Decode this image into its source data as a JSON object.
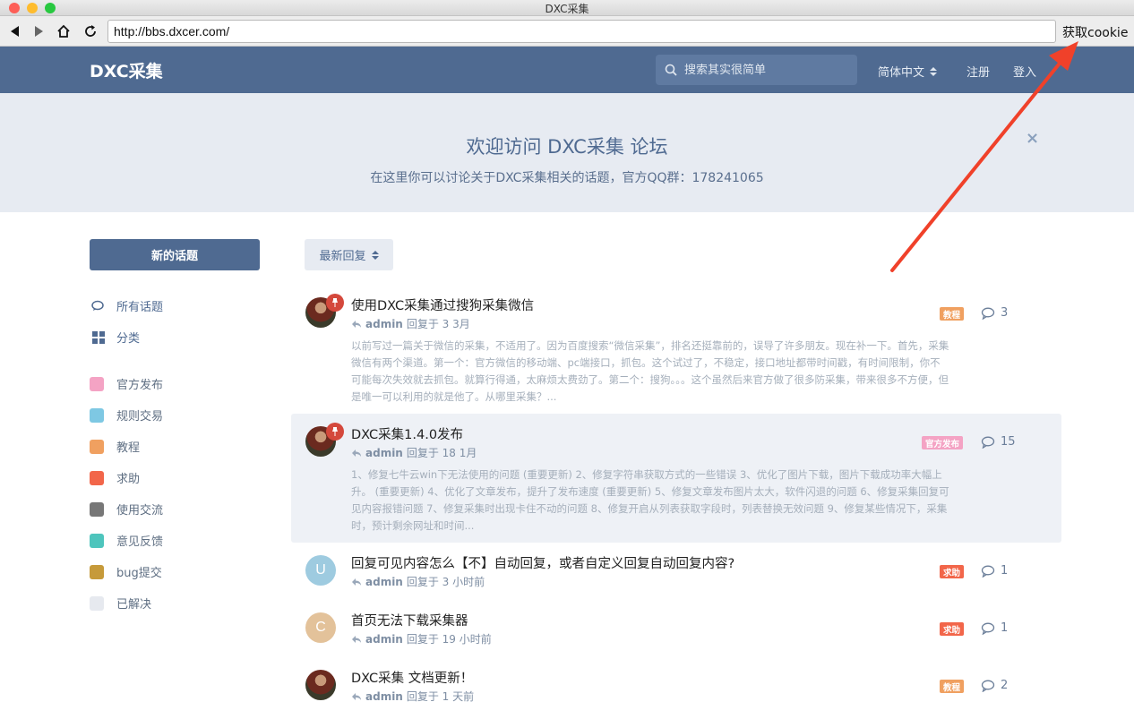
{
  "window": {
    "title": "DXC采集"
  },
  "browser": {
    "url": "http://bbs.dxcer.com/",
    "cookie_label": "获取cookie"
  },
  "header": {
    "logo": "DXC采集",
    "search_placeholder": "搜索其实很简单",
    "language": "简体中文",
    "register": "注册",
    "login": "登入"
  },
  "hero": {
    "title": "欢迎访问 DXC采集 论坛",
    "subtitle": "在这里你可以讨论关于DXC采集相关的话题，官方QQ群：178241065",
    "close": "×"
  },
  "sidebar": {
    "new_topic": "新的话题",
    "nav": [
      {
        "label": "所有话题",
        "icon": "comments-icon"
      },
      {
        "label": "分类",
        "icon": "grid-icon"
      }
    ],
    "tags": [
      {
        "label": "官方发布",
        "color": "#f4a3c4"
      },
      {
        "label": "规则交易",
        "color": "#7ec8e3"
      },
      {
        "label": "教程",
        "color": "#f0a060"
      },
      {
        "label": "求助",
        "color": "#f2664a"
      },
      {
        "label": "使用交流",
        "color": "#777777"
      },
      {
        "label": "意见反馈",
        "color": "#4ec5bd"
      },
      {
        "label": "bug提交",
        "color": "#c69a3a"
      },
      {
        "label": "已解决",
        "color": "#e6e9ef"
      }
    ]
  },
  "sort": {
    "label": "最新回复"
  },
  "topics": [
    {
      "title": "使用DXC采集通过搜狗采集微信",
      "user": "admin",
      "reply_text": "回复于 3 3月",
      "excerpt": "以前写过一篇关于微信的采集，不适用了。因为百度搜索“微信采集”，排名还挺靠前的，误导了许多朋友。现在补一下。首先，采集微信有两个渠道。第一个：官方微信的移动端、pc端接口，抓包。这个试过了，不稳定，接口地址都带时间戳，有时间限制，你不可能每次失效就去抓包。就算行得通，太麻烦太费劲了。第二个：搜狗。。。这个虽然后来官方做了很多防采集，带来很多不方便，但是唯一可以利用的就是他了。从哪里采集？...",
      "tag": "教程",
      "tag_color": "#f0a060",
      "count": "3"
    },
    {
      "title": "DXC采集1.4.0发布",
      "user": "admin",
      "reply_text": "回复于 18 1月",
      "excerpt": "1、修复七牛云win下无法使用的问题 (重要更新) 2、修复字符串获取方式的一些错误 3、优化了图片下载，图片下载成功率大幅上升。 (重要更新) 4、优化了文章发布，提升了发布速度 (重要更新) 5、修复文章发布图片太大，软件闪退的问题 6、修复采集回复可见内容报错问题 7、修复采集时出现卡住不动的问题 8、修复开启从列表获取字段时，列表替换无效问题 9、修复某些情况下，采集时，预计剩余网址和时间...",
      "tag": "官方发布",
      "tag_color": "#f4a3c4",
      "count": "15"
    },
    {
      "title": "回复可见内容怎么【不】自动回复，或者自定义回复自动回复内容?",
      "user": "admin",
      "reply_text": "回复于 3 小时前",
      "avatar_letter": "U",
      "avatar_color": "#9ecbe0",
      "tag": "求助",
      "tag_color": "#f2664a",
      "count": "1"
    },
    {
      "title": "首页无法下载采集器",
      "user": "admin",
      "reply_text": "回复于 19 小时前",
      "avatar_letter": "C",
      "avatar_color": "#e3c29a",
      "tag": "求助",
      "tag_color": "#f2664a",
      "count": "1"
    },
    {
      "title": "DXC采集 文档更新！",
      "user": "admin",
      "reply_text": "回复于 1 天前",
      "tag": "教程",
      "tag_color": "#f0a060",
      "count": "2"
    }
  ]
}
